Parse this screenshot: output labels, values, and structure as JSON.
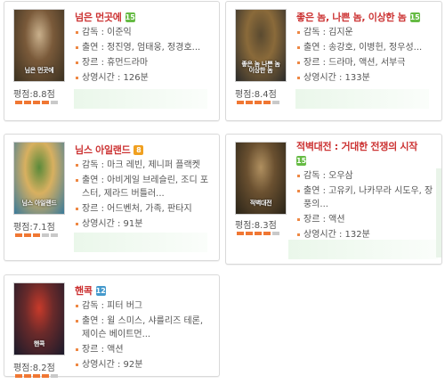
{
  "movies": [
    {
      "title": "넘은 먼곳에",
      "rating_age": "15",
      "badge_color": "#66bb44",
      "director": "감독 : 이준익",
      "cast": "출연 : 정진영, 엄태웅, 정경호...",
      "genre": "장르 : 휴먼드라마",
      "runtime": "상영시간 : 126분",
      "score": "평점:8.8점",
      "stars_on": 4,
      "stars_total": 5,
      "poster_caption": "님은 먼곳에",
      "poster_colors": [
        "#3a3020",
        "#7a5a3a",
        "#c9b08c"
      ]
    },
    {
      "title": "좋은 놈, 나쁜 놈, 이상한 놈",
      "rating_age": "15",
      "badge_color": "#66bb44",
      "director": "감독 : 김지운",
      "cast": "출연 : 송강호, 이병헌, 정우성...",
      "genre": "장르 : 드라마, 액션, 서부극",
      "runtime": "상영시간 : 133분",
      "score": "평점:8.4점",
      "stars_on": 4,
      "stars_total": 5,
      "poster_caption": "좋은 놈 나쁜 놈 이상한 놈",
      "poster_colors": [
        "#2a2a2a",
        "#8a6a3a",
        "#5a4a30"
      ]
    },
    {
      "title": "님스 아일랜드",
      "rating_age": "8",
      "badge_color": "#f0a020",
      "director": "감독 : 마크 레빈, 제니퍼 플랙켓",
      "cast": "출연 : 아비게일 브레슬린, 조디 포스터, 제라드 버틀러...",
      "genre": "장르 : 어드벤처, 가족, 판타지",
      "runtime": "상영시간 : 91분",
      "score": "평점:7.1점",
      "stars_on": 3,
      "stars_total": 5,
      "poster_caption": "님스 아일랜드",
      "poster_colors": [
        "#3a7a9a",
        "#d8b060",
        "#5a8a3a"
      ]
    },
    {
      "title": "적벽대전 : 거대한 전쟁의 시작",
      "rating_age": "15",
      "badge_color": "#66bb44",
      "director": "감독 : 오우삼",
      "cast": "출연 : 고유키, 나카무라 시도우, 장풍의...",
      "genre": "장르 : 액션",
      "runtime": "상영시간 : 132분",
      "score": "평점:8.3점",
      "stars_on": 4,
      "stars_total": 5,
      "poster_caption": "적벽대전",
      "poster_colors": [
        "#2a2418",
        "#6a5030",
        "#b09060"
      ]
    },
    {
      "title": "핸콕",
      "rating_age": "12",
      "badge_color": "#4499cc",
      "director": "감독 : 피터 버그",
      "cast": "출연 : 윌 스미스, 샤를리즈 테론, 제이슨 베이트먼...",
      "genre": "장르 : 액션",
      "runtime": "상영시간 : 92분",
      "score": "평점:8.2점",
      "stars_on": 4,
      "stars_total": 5,
      "poster_caption": "핸콕",
      "poster_colors": [
        "#1a1a2a",
        "#6a2a2a",
        "#c83a2a"
      ]
    }
  ]
}
